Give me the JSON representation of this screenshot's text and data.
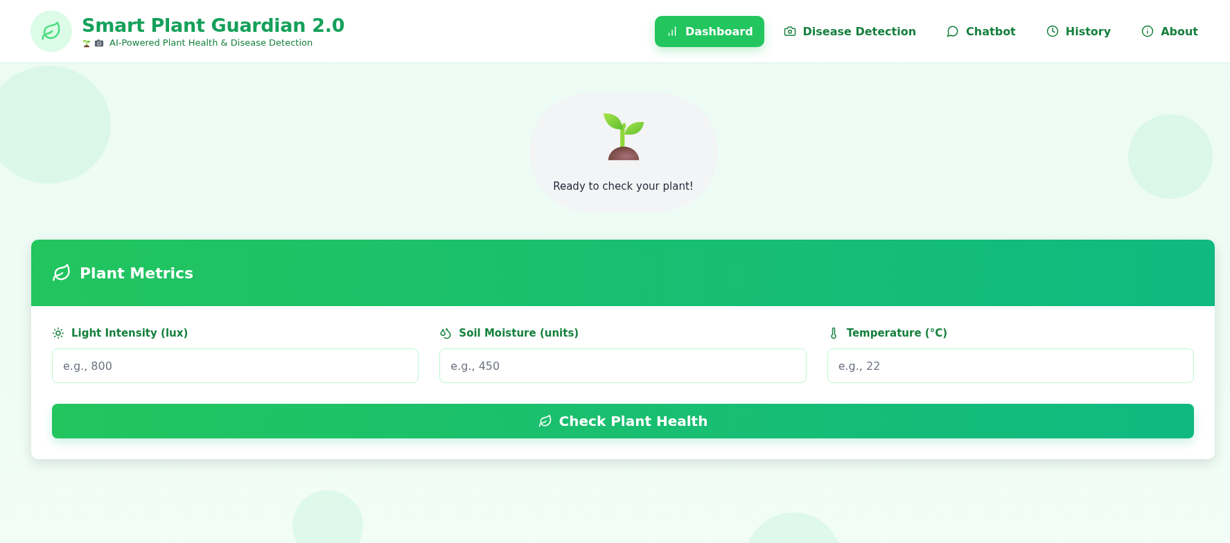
{
  "header": {
    "title": "Smart Plant Guardian 2.0",
    "subtitle": "AI-Powered Plant Health & Disease Detection"
  },
  "nav": [
    {
      "label": "Dashboard",
      "selected": true
    },
    {
      "label": "Disease Detection",
      "selected": false
    },
    {
      "label": "Chatbot",
      "selected": false
    },
    {
      "label": "History",
      "selected": false
    },
    {
      "label": "About",
      "selected": false
    }
  ],
  "status": {
    "message": "Ready to check your plant!"
  },
  "metrics_card": {
    "title": "Plant Metrics",
    "fields": [
      {
        "label": "Light Intensity (lux)",
        "placeholder": "e.g., 800"
      },
      {
        "label": "Soil Moisture (units)",
        "placeholder": "e.g., 450"
      },
      {
        "label": "Temperature (°C)",
        "placeholder": "e.g., 22"
      }
    ],
    "button": "Check Plant Health"
  }
}
